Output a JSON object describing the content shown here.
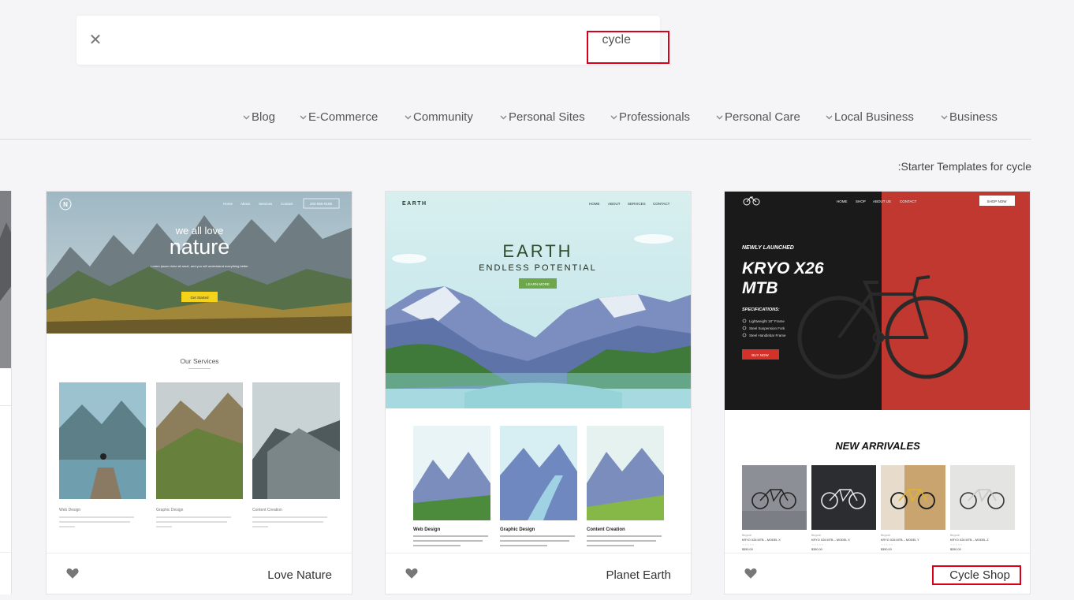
{
  "search": {
    "query": "cycle",
    "clear_icon": "close-icon"
  },
  "categories": [
    "Blog",
    "E-Commerce",
    "Community",
    "Personal Sites",
    "Professionals",
    "Personal Care",
    "Local Business",
    "Business"
  ],
  "results_label": ":Starter Templates for cycle",
  "cards": [
    {
      "name": "Love Nature",
      "preview": {
        "nav": [
          "Home",
          "About",
          "Services",
          "Contact"
        ],
        "phone": "202-555-0188",
        "hero_small": "we all love",
        "hero_big": "nature",
        "hero_sub": "Lorem ipsum dolor sit amet, and you will understand everything better",
        "cta": "Get Started",
        "section_title": "Our Services",
        "services": [
          "Web Design",
          "Graphic Design",
          "Content Creation"
        ]
      }
    },
    {
      "name": "Planet Earth",
      "preview": {
        "logo": "EARTH",
        "nav": [
          "HOME",
          "ABOUT",
          "SERVICES",
          "CONTACT"
        ],
        "hero_title": "EARTH",
        "hero_sub": "ENDLESS POTENTIAL",
        "cta": "LEARN MORE",
        "services": [
          "Web Design",
          "Graphic Design",
          "Content Creation"
        ]
      }
    },
    {
      "name": "Cycle Shop",
      "preview": {
        "nav": [
          "HOME",
          "SHOP",
          "ABOUT US",
          "CONTACT"
        ],
        "nav_cta": "SHOP NOW",
        "kicker": "NEWLY LAUNCHED",
        "title_line1": "KRYO X26",
        "title_line2": "MTB",
        "spec_title": "SPECIFICATIONS:",
        "specs": [
          "Lightweight 18\" Frame",
          "Steel Suspension Fork",
          "Steel Handlebar Frame"
        ],
        "cta": "BUY NOW",
        "section_title": "NEW ARRIVALES",
        "products": [
          {
            "cat": "Bicycle",
            "name": "KRYO X26 MTB – MODEL X",
            "price": "$350.00"
          },
          {
            "cat": "Bicycle",
            "name": "KRYO X26 MTB – MODEL X",
            "price": "$350.00"
          },
          {
            "cat": "Bicycle",
            "name": "KRYO X26 MTB – MODEL Y",
            "price": "$350.00"
          },
          {
            "cat": "Bicycle",
            "name": "KRYO X26 MTB – MODEL Z",
            "price": "$350.00"
          }
        ]
      }
    }
  ],
  "colors": {
    "highlight": "#d9001b",
    "accent_yellow": "#f5d31a",
    "accent_green": "#6ea64b",
    "cycle_red": "#c0382f"
  }
}
